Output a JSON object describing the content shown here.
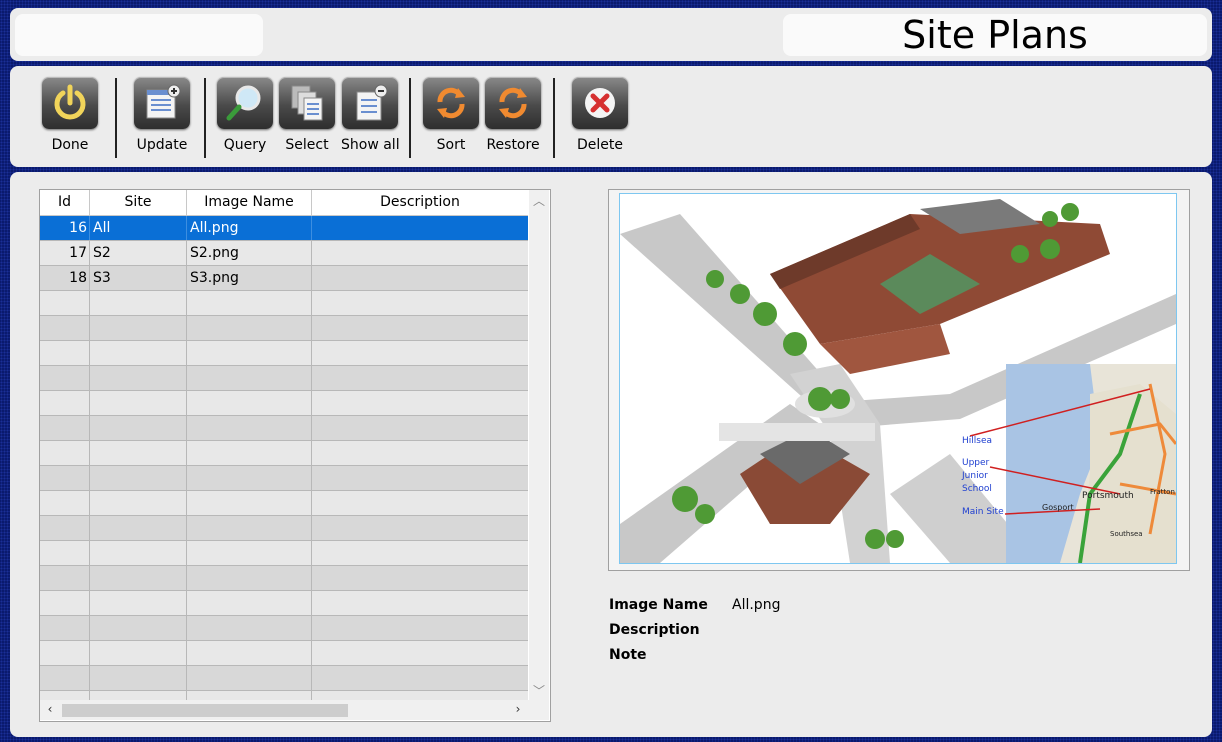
{
  "header": {
    "title": "Site Plans"
  },
  "toolbar": {
    "done": "Done",
    "update": "Update",
    "query": "Query",
    "select": "Select",
    "show_all": "Show all",
    "sort": "Sort",
    "restore": "Restore",
    "delete": "Delete"
  },
  "grid": {
    "columns": [
      "Id",
      "Site",
      "Image Name",
      "Description"
    ],
    "rows": [
      {
        "id": "16",
        "site": "All",
        "image": "All.png",
        "description": ""
      },
      {
        "id": "17",
        "site": "S2",
        "image": "S2.png",
        "description": ""
      },
      {
        "id": "18",
        "site": "S3",
        "image": "S3.png",
        "description": ""
      }
    ],
    "selected_index": 0
  },
  "preview": {
    "map_labels": {
      "hillsea": "Hillsea",
      "upper": "Upper",
      "junior": "Junior",
      "school": "School",
      "main_site": "Main Site",
      "portsmouth": "Portsmouth",
      "gosport": "Gosport",
      "southsea": "Southsea",
      "fratton": "Fratton"
    }
  },
  "details": {
    "image_name_label": "Image Name",
    "image_name_value": "All.png",
    "description_label": "Description",
    "note_label": "Note"
  },
  "colors": {
    "background": "#0a1a6e",
    "selection": "#0a6fd6",
    "panel": "#ececec"
  }
}
